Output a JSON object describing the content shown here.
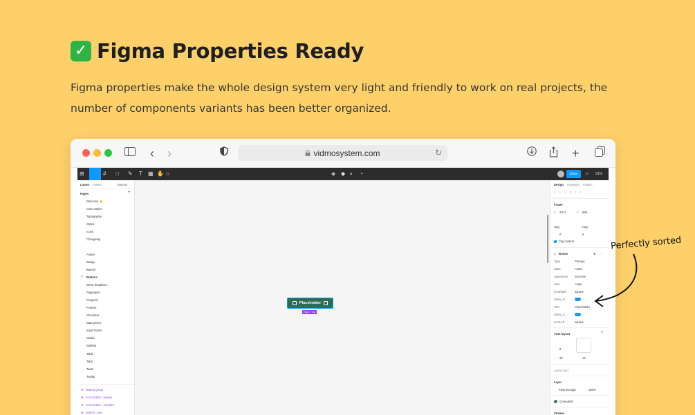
{
  "header": {
    "check_glyph": "✓",
    "title": "Figma Properties Ready",
    "description": "Figma properties make the whole design system very light and friendly to work on real projects, the number of components variants has been better organized."
  },
  "browser": {
    "url": "vidmosystem.com"
  },
  "figma": {
    "share": "Share",
    "zoom": "91%",
    "left_tabs": [
      "Layers",
      "Assets"
    ],
    "left_tab_right": "Buttons",
    "pages_label": "Pages",
    "pages": [
      "Welcome 👋",
      "Color Styles",
      "Typography",
      "Styles",
      "Icons",
      "Changelog"
    ],
    "components": [
      "Avatar",
      "Badge",
      "Banner",
      "Buttons",
      "Menu dropdown",
      "Pagination",
      "Progress",
      "Feature",
      "Checkbox",
      "Date picker",
      "Input Forms",
      "Modal",
      "Sidebar",
      "Table",
      "Tabs",
      "Toast",
      "Tooltip"
    ],
    "layers": [
      "Button group",
      "Icon button - square",
      "Icon button - rounded",
      "Button - text"
    ],
    "right_tabs": [
      "Design",
      "Prototype",
      "Inspect"
    ],
    "frame": {
      "label": "Frame",
      "x": "2317",
      "y": "598",
      "w_mode": "Hug",
      "h_mode": "Hug",
      "rotation": "0°",
      "radius": "8",
      "clip": "Clip content"
    },
    "component": {
      "name": "Button",
      "props": [
        [
          "Type",
          "Primary"
        ],
        [
          "State",
          "Active"
        ],
        [
          "Apperance",
          "Success"
        ],
        [
          "Size",
          "Large"
        ],
        [
          "IconRight",
          "square"
        ],
        [
          "Show_Ic...",
          ""
        ],
        [
          "Text",
          "Placeholder"
        ],
        [
          "Show_Ic...",
          ""
        ],
        [
          "IconLeft",
          "square"
        ]
      ]
    },
    "autolayout": {
      "label": "Auto layout",
      "gap": "8",
      "pad_h": "20",
      "pad_v": "12"
    },
    "layout_grid": "Layout grid",
    "layer": {
      "label": "Layer",
      "blend": "Pass through",
      "opacity": "100%"
    },
    "fill": {
      "name": "Green/500",
      "color": "#2e7d5b"
    },
    "strokes": "Strokes",
    "canvas_button": {
      "label": "Placeholder",
      "hug": "Hug × Hug"
    }
  },
  "annotation": "Perfectly sorted",
  "colors": {
    "bg": "#FDD06A",
    "accent": "#0d99ff",
    "green": "#2e6b52",
    "purple": "#8a3ffc"
  }
}
